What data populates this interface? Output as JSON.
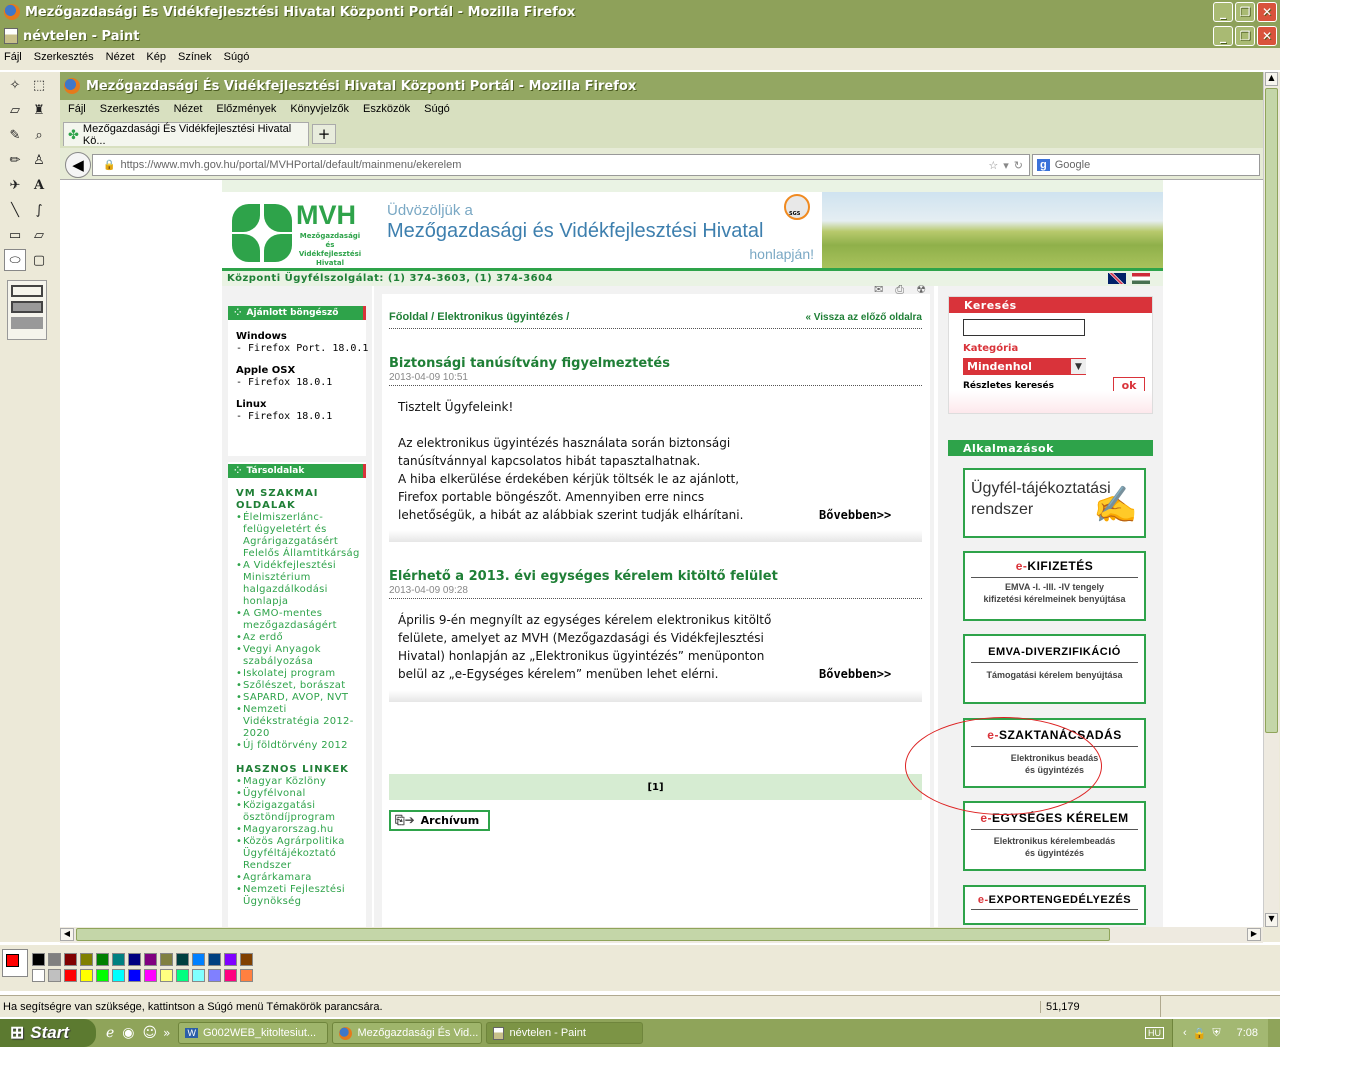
{
  "outer_window": {
    "title": "Mezőgazdasági És Vidékfejlesztési Hivatal Központi Portál - Mozilla Firefox"
  },
  "paint_window": {
    "title": "névtelen - Paint",
    "menu": [
      "Fájl",
      "Szerkesztés",
      "Nézet",
      "Kép",
      "Színek",
      "Súgó"
    ],
    "status_text": "Ha segítségre van szüksége, kattintson a Súgó menü Témakörök parancsára.",
    "coords": "51,179",
    "palette_colors": [
      "#000000",
      "#808080",
      "#800000",
      "#808000",
      "#008000",
      "#008080",
      "#000080",
      "#800080",
      "#808040",
      "#004040",
      "#0080ff",
      "#004080",
      "#8000ff",
      "#804000",
      "#ffffff",
      "#c0c0c0",
      "#ff0000",
      "#ffff00",
      "#00ff00",
      "#00ffff",
      "#0000ff",
      "#ff00ff",
      "#ffff80",
      "#00ff80",
      "#80ffff",
      "#8080ff",
      "#ff0080",
      "#ff8040"
    ]
  },
  "firefox": {
    "title": "Mezőgazdasági És Vidékfejlesztési Hivatal Központi Portál - Mozilla Firefox",
    "menu": [
      "Fájl",
      "Szerkesztés",
      "Nézet",
      "Előzmények",
      "Könyvjelzők",
      "Eszközök",
      "Súgó"
    ],
    "tab_label": "Mezőgazdasági És Vidékfejlesztési Hivatal Kö...",
    "new_tab": "+",
    "url": "https://www.mvh.gov.hu/portal/MVHPortal/default/mainmenu/ekerelem",
    "search_placeholder": "Google"
  },
  "site": {
    "logo_text": "MVH",
    "logo_sub": "Mezőgazdasági és Vidékfejlesztési Hivatal",
    "welcome_line1": "Üdvözöljük a",
    "welcome_line2": "Mezőgazdasági és Vidékfejlesztési Hivatal",
    "welcome_line3": "honlapján!",
    "sgs": "SGS",
    "service_line": "Központi Ügyfélszolgálat: (1) 374-3603, (1) 374-3604",
    "left": {
      "browser_header": "Ajánlott böngésző",
      "browsers": [
        {
          "os": "Windows",
          "version": "- Firefox Port. 18.0.1"
        },
        {
          "os": "Apple OSX",
          "version": "- Firefox 18.0.1"
        },
        {
          "os": "Linux",
          "version": "- Firefox 18.0.1"
        }
      ],
      "sites_header": "Társoldalak",
      "group1_title": "VM SZAKMAI OLDALAK",
      "group1_items": [
        "Élelmiszerlánc-felügyeletért és Agrárigazgatásért Felelős Államtitkárság",
        "A Vidékfejlesztési Minisztérium halgazdálkodási honlapja",
        "A GMO-mentes mezőgazdaságért",
        "Az erdő",
        "Vegyi Anyagok szabályozása",
        "Iskolatej program",
        "Szőlészet, borászat",
        "SAPARD, AVOP, NVT",
        "Nemzeti Vidékstratégia 2012-2020",
        "Új földtörvény 2012"
      ],
      "group2_title": "HASZNOS LINKEK",
      "group2_items": [
        "Magyar Közlöny",
        "Ügyfélvonal",
        "Közigazgatási ösztöndíjprogram",
        "Magyarorszag.hu",
        "Közös Agrárpolitika Ügyféltájékoztató Rendszer",
        "Agrárkamara",
        "Nemzeti Fejlesztési Ügynökség"
      ]
    },
    "center": {
      "breadcrumb": "Főoldal / Elektronikus ügyintézés /",
      "back_link": "« Vissza az előző oldalra",
      "news": [
        {
          "title": "Biztonsági tanúsítvány figyelmeztetés",
          "date": "2013-04-09 10:51",
          "body_lines": [
            "Tisztelt Ügyfeleink!",
            "",
            "Az elektronikus ügyintézés használata során biztonsági",
            "tanúsítvánnyal kapcsolatos hibát tapasztalhatnak.",
            "A hiba elkerülése érdekében kérjük töltsék le az ajánlott,",
            "Firefox portable böngészőt. Amennyiben erre nincs",
            "lehetőségük, a hibát az alábbiak szerint tudják elhárítani."
          ],
          "more": "Bővebben>>"
        },
        {
          "title": "Elérhető a 2013. évi egységes kérelem kitöltő felület",
          "date": "2013-04-09 09:28",
          "body_lines": [
            "Április 9-én megnyílt az egységes kérelem elektronikus kitöltő",
            "felülete, amelyet az MVH (Mezőgazdasági és Vidékfejlesztési",
            "Hivatal) honlapján az „Elektronikus ügyintézés” menüponton",
            "belül az „e-Egységes kérelem” menüben lehet elérni."
          ],
          "more": "Bővebben>>"
        }
      ],
      "pager": "[1]",
      "archive": "Archívum"
    },
    "right": {
      "search_header": "Keresés",
      "category_label": "Kategória",
      "category_value": "Mindenhol",
      "detailed_search": "Részletes keresés",
      "ok": "ok",
      "apps_header": "Alkalmazások",
      "apps": [
        {
          "title_line1": "Ügyfél-tájékoztatási",
          "title_line2": "rendszer"
        },
        {
          "prefix": "e-",
          "title": "KIFIZETÉS",
          "desc_line1": "EMVA -I. -III. -IV tengely",
          "desc_line2": "kifizetési kérelmeinek benyújtása"
        },
        {
          "title": "EMVA-DIVERZIFIKÁCIÓ",
          "desc_line1": "Támogatási kérelem benyújtása"
        },
        {
          "prefix": "e-",
          "title": "SZAKTANÁCSADÁS",
          "desc_line1": "Elektronikus beadás",
          "desc_line2": "és ügyintézés"
        },
        {
          "prefix": "e-",
          "title": "EGYSÉGES KÉRELEM",
          "desc_line1": "Elektronikus kérelembeadás",
          "desc_line2": "és ügyintézés"
        },
        {
          "prefix": "e-",
          "title": "EXPORTENGEDÉLYEZÉS"
        }
      ]
    }
  },
  "taskbar": {
    "start": "Start",
    "tasks": [
      "G002WEB_kitoltesiut...",
      "Mezőgazdasági És Vid...",
      "névtelen - Paint"
    ],
    "lang": "HU",
    "time": "7:08"
  }
}
